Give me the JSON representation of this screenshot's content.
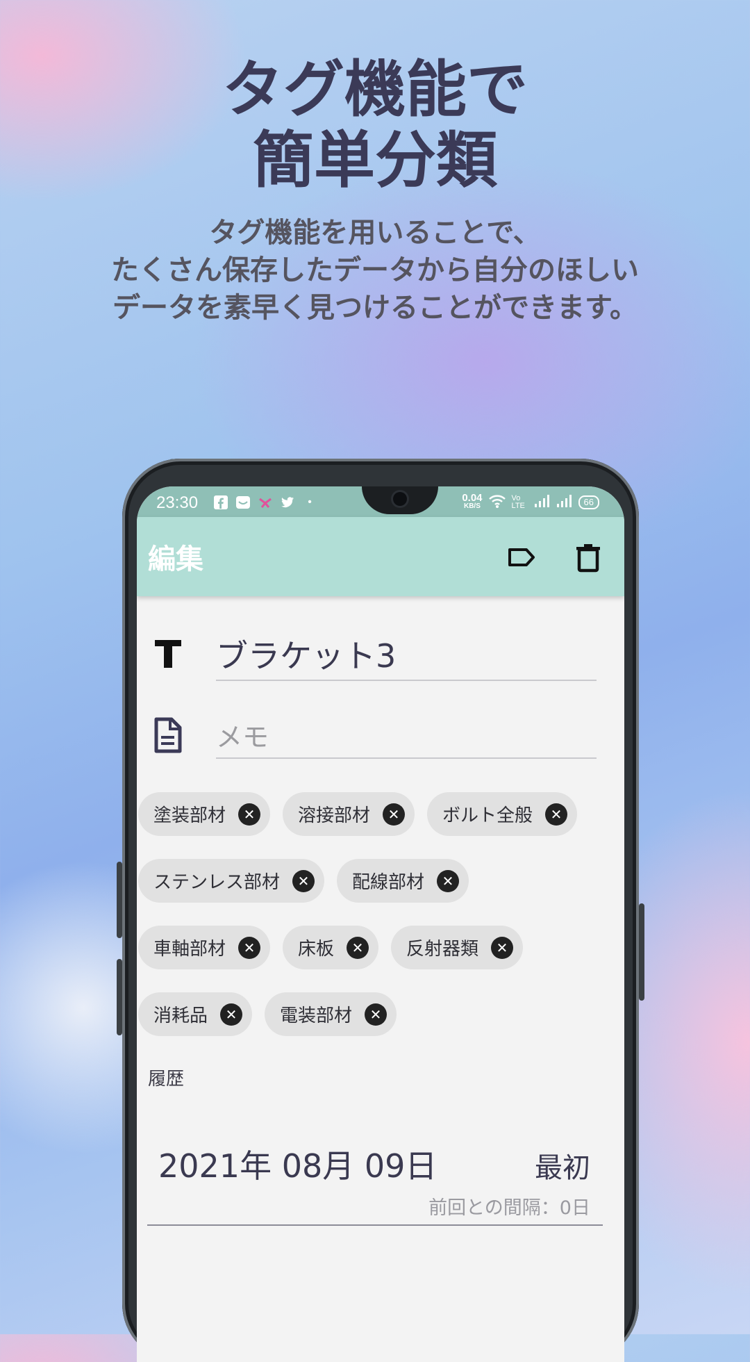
{
  "promo": {
    "headline_line1": "タグ機能で",
    "headline_line2": "簡単分類",
    "sub_line1": "タグ機能を用いることで、",
    "sub_line2": "たくさん保存したデータから自分のほしい",
    "sub_line3": "データを素早く見つけることができます。"
  },
  "status_bar": {
    "time": "23:30",
    "net_speed": "0.04",
    "net_unit": "KB/S",
    "volte": "Vo LTE",
    "battery": "66",
    "notification_icons": [
      "facebook-icon",
      "mail-icon",
      "app-icon",
      "twitter-icon",
      "dot-icon"
    ]
  },
  "appbar": {
    "title": "編集",
    "icons": [
      "tag-icon",
      "trash-icon"
    ]
  },
  "form": {
    "title_value": "ブラケット3",
    "memo_placeholder": "メモ"
  },
  "tags": [
    [
      "塗装部材",
      "溶接部材",
      "ボルト全般"
    ],
    [
      "ステンレス部材",
      "配線部材"
    ],
    [
      "車軸部材",
      "床板",
      "反射器類"
    ],
    [
      "消耗品",
      "電装部材"
    ]
  ],
  "history": {
    "label": "履歴",
    "date": "2021年 08月 09日",
    "first": "最初",
    "interval": "前回との間隔：0日"
  },
  "colors": {
    "appbar": "#b1ded6",
    "headline": "#3b3a57",
    "chip_bg": "#e1e1e1"
  }
}
